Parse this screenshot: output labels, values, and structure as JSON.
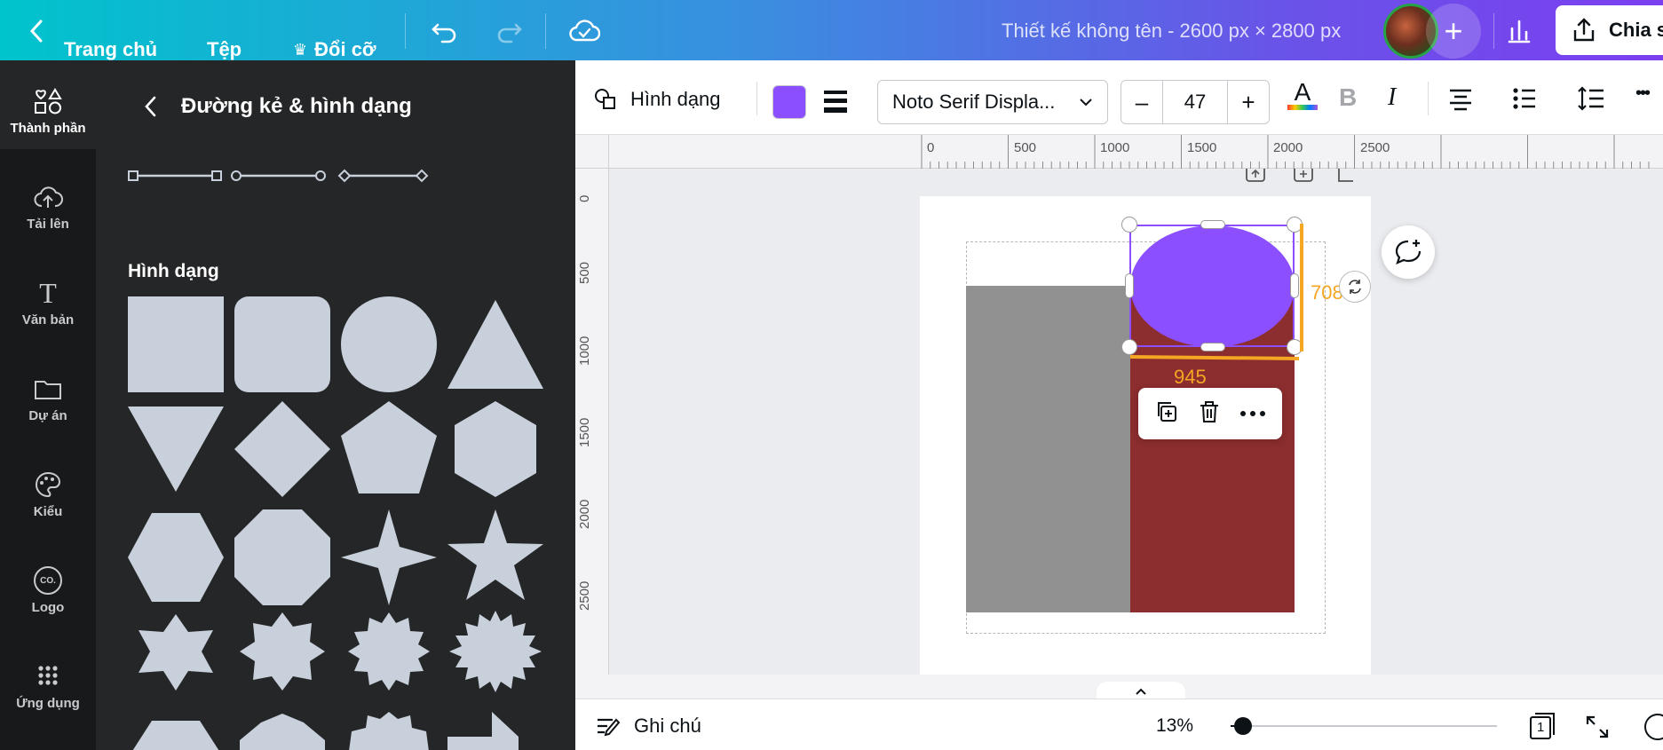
{
  "topbar": {
    "home_label": "Trang chủ",
    "file_label": "Tệp",
    "resize_label": "Đổi cỡ",
    "crown_glyph": "♛",
    "doc_title": "Thiết kế không tên - 2600 px × 2800 px",
    "share_label": "Chia s",
    "add_glyph": "+"
  },
  "rail": {
    "items": [
      {
        "label": "Thành phần",
        "icon": "elements-icon"
      },
      {
        "label": "Tải lên",
        "icon": "upload-icon"
      },
      {
        "label": "Văn bản",
        "icon": "text-icon"
      },
      {
        "label": "Dự án",
        "icon": "folder-icon"
      },
      {
        "label": "Kiểu",
        "icon": "palette-icon"
      },
      {
        "label": "Logo",
        "icon": "logo-icon"
      },
      {
        "label": "Ứng dụng",
        "icon": "apps-icon"
      }
    ],
    "text_glyph": "T",
    "logo_glyph": "CO."
  },
  "panel": {
    "title": "Đường kẻ & hình dạng",
    "section_shapes": "Hình dạng"
  },
  "toolbar": {
    "shape_label": "Hình dạng",
    "fill_color": "#8b4fff",
    "font_name": "Noto Serif Displa...",
    "font_size": "47",
    "minus": "–",
    "plus": "+",
    "text_color_glyph": "A",
    "bold_glyph": "B",
    "italic_glyph": "I",
    "more_glyph": "•••"
  },
  "ruler": {
    "h_ticks": [
      "0",
      "500",
      "1000",
      "1500",
      "2000",
      "2500"
    ],
    "v_ticks": [
      "0",
      "500",
      "1000",
      "1500",
      "2000",
      "2500"
    ]
  },
  "canvas": {
    "height_label": "708",
    "width_label": "945",
    "colors": {
      "gray": "#919191",
      "red": "#8c2d2f",
      "purple": "#8b4fff",
      "measure": "#f5a623"
    }
  },
  "bottom": {
    "notes_label": "Ghi chú",
    "zoom": "13%",
    "zoom_fraction": 0.13,
    "page_count": "1"
  }
}
